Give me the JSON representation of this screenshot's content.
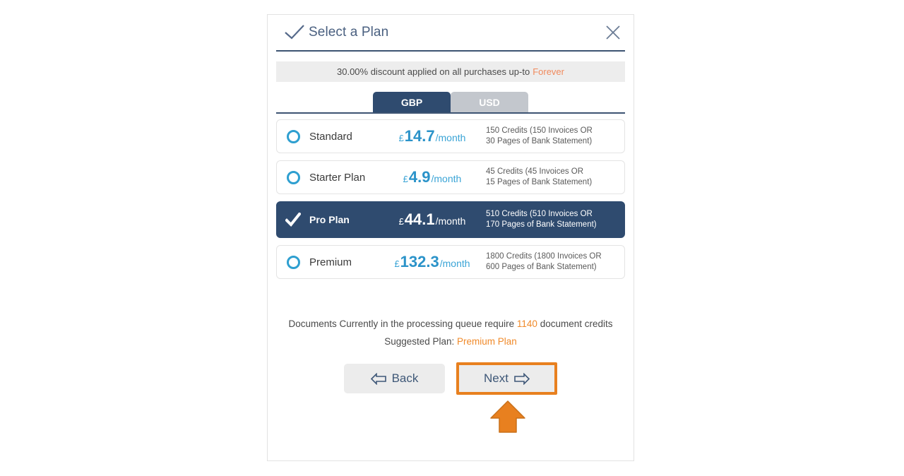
{
  "modal": {
    "title": "Select a Plan",
    "title_icon": "check-icon",
    "close_icon": "close-icon",
    "discount": {
      "text": "30.00% discount applied on all purchases up-to",
      "highlight": "Forever",
      "highlight_color": "#f08a5d"
    },
    "currency_tabs": [
      {
        "label": "GBP",
        "active": true
      },
      {
        "label": "USD",
        "active": false
      }
    ],
    "plans": [
      {
        "name": "Standard",
        "currency": "£",
        "amount": "14.7",
        "period": "/month",
        "desc_line1": "150 Credits (150 Invoices OR",
        "desc_line2": "30 Pages of Bank Statement)",
        "selected": false
      },
      {
        "name": "Starter Plan",
        "currency": "£",
        "amount": "4.9",
        "period": "/month",
        "desc_line1": "45 Credits (45 Invoices OR",
        "desc_line2": "15 Pages of Bank Statement)",
        "selected": false
      },
      {
        "name": "Pro Plan",
        "currency": "£",
        "amount": "44.1",
        "period": "/month",
        "desc_line1": "510 Credits (510 Invoices OR",
        "desc_line2": "170 Pages of Bank Statement)",
        "selected": true
      },
      {
        "name": "Premium",
        "currency": "£",
        "amount": "132.3",
        "period": "/month",
        "desc_line1": "1800 Credits (1800 Invoices OR",
        "desc_line2": "600 Pages of Bank Statement)",
        "selected": false
      }
    ],
    "queue": {
      "prefix": "Documents Currently in the processing queue require",
      "credits": "1140",
      "suffix": "document credits"
    },
    "suggested": {
      "label": "Suggested Plan:",
      "plan": "Premium Plan"
    },
    "buttons": {
      "back_label": "Back",
      "back_icon": "arrow-left-icon",
      "next_label": "Next",
      "next_icon": "arrow-right-icon",
      "next_highlight_color": "#e8801f"
    }
  },
  "pointer": {
    "icon": "up-arrow-pointer",
    "color": "#e8801f"
  }
}
